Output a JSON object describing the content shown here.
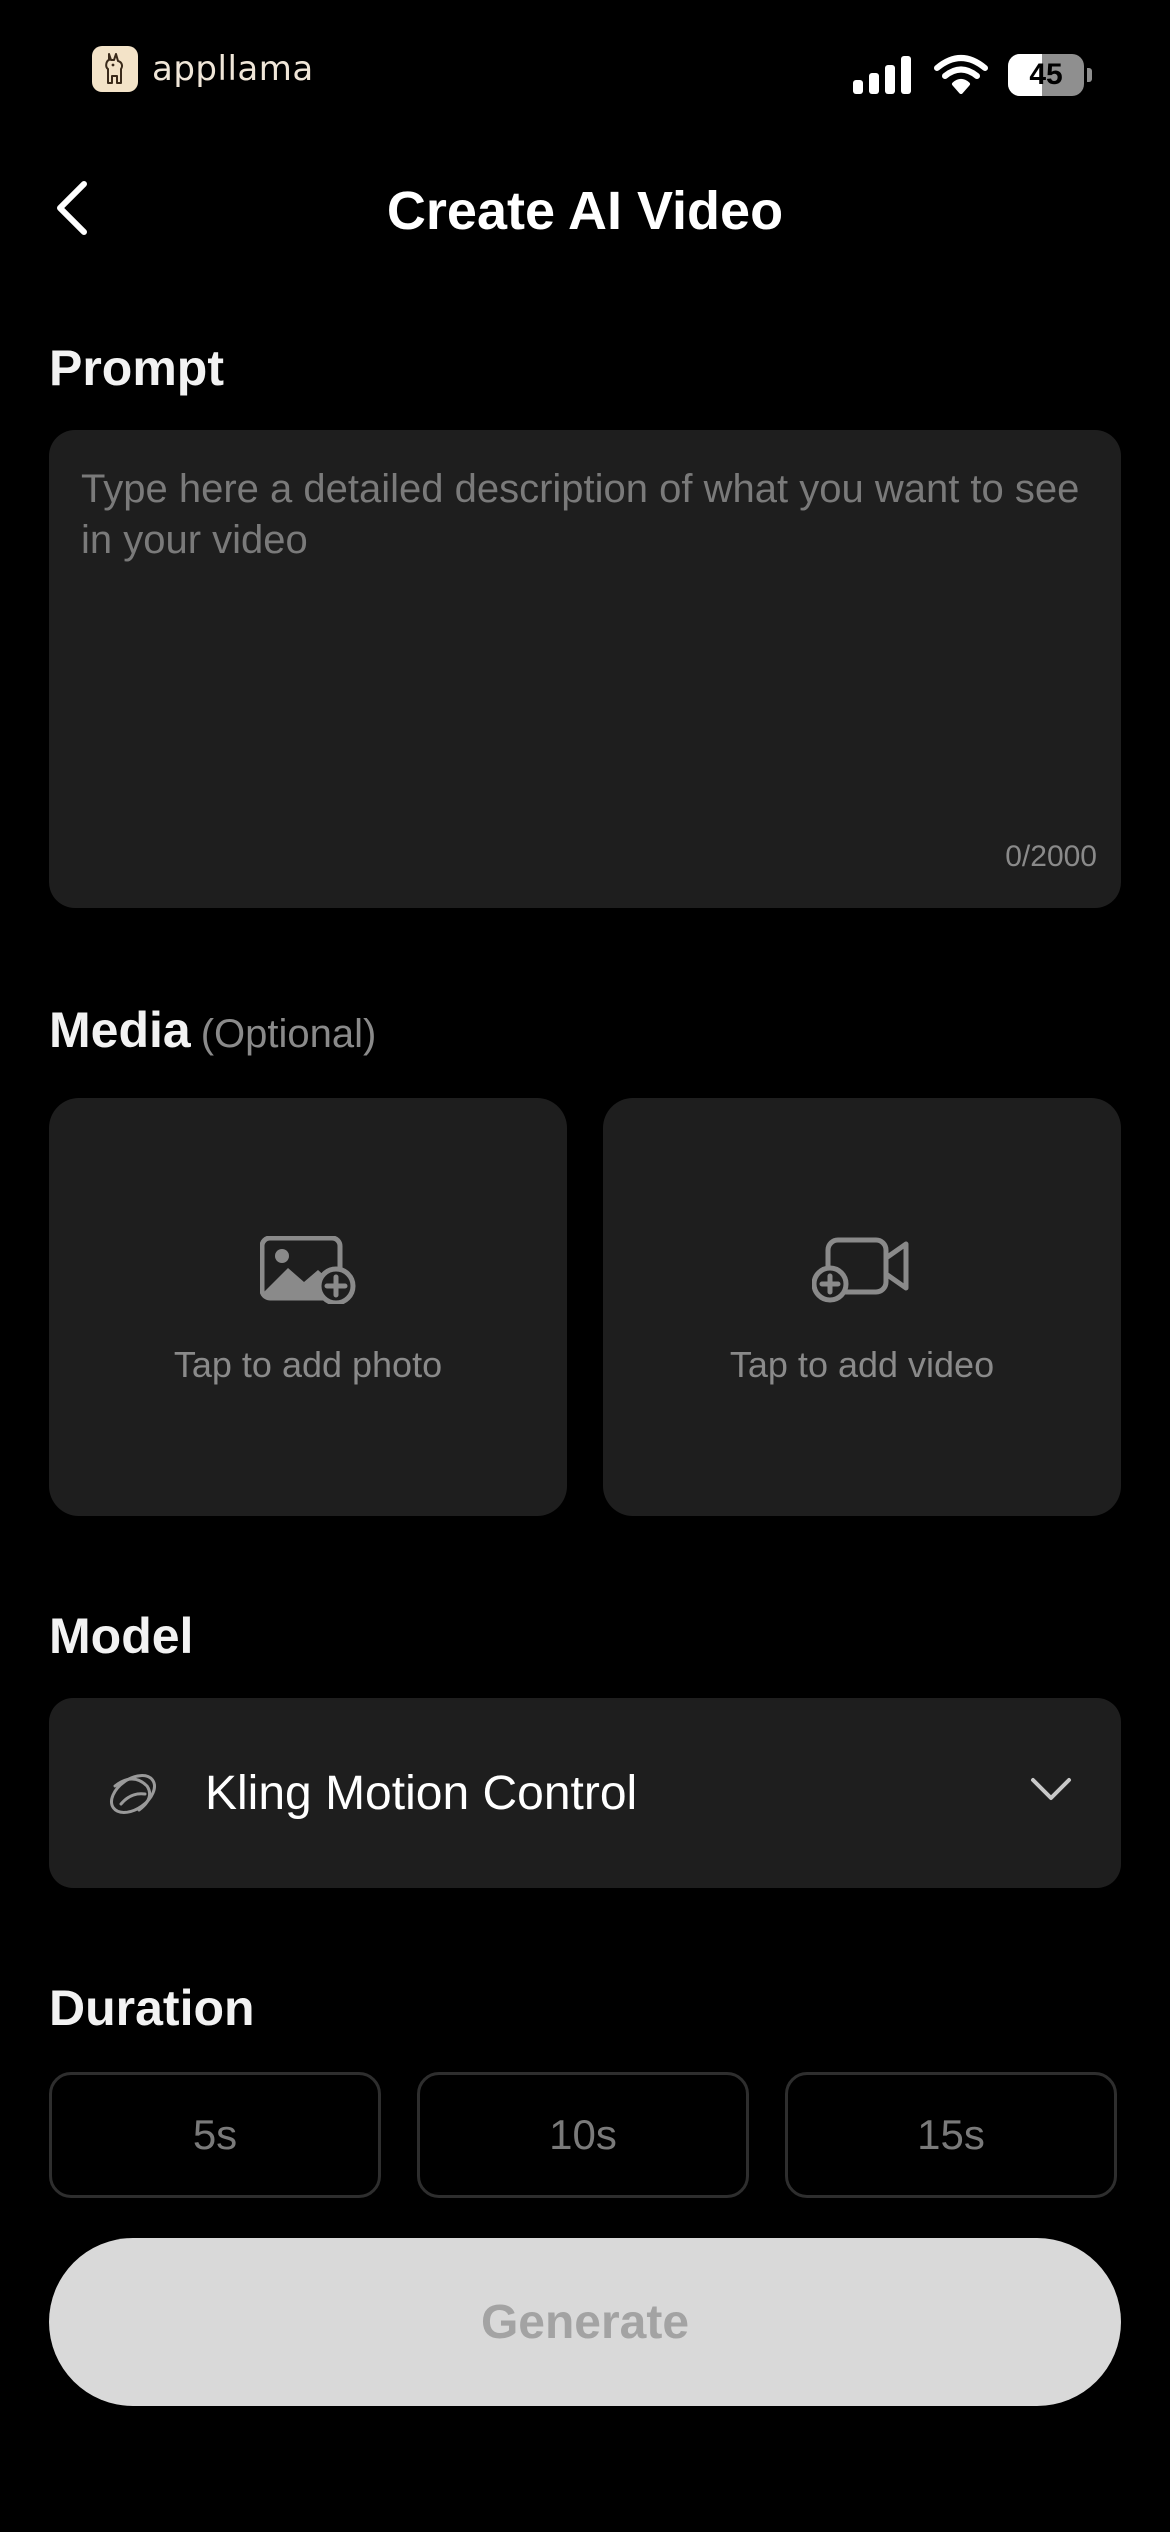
{
  "status_bar": {
    "brand_name": "appllama",
    "battery_level": "45",
    "battery_fraction": 0.45,
    "signal_icon": "cellular-signal-icon",
    "wifi_icon": "wifi-icon"
  },
  "header": {
    "back_icon": "chevron-left-icon",
    "title": "Create AI Video"
  },
  "prompt": {
    "label": "Prompt",
    "placeholder": "Type here a detailed description of what you want to see in your video",
    "value": "",
    "counter": "0/2000"
  },
  "media": {
    "label": "Media",
    "optional_label": "(Optional)",
    "photo": {
      "icon": "add-photo-icon",
      "label": "Tap to add photo"
    },
    "video": {
      "icon": "add-video-icon",
      "label": "Tap to add video"
    }
  },
  "model": {
    "label": "Model",
    "selected": "Kling Motion Control",
    "icon": "kling-logo-icon",
    "chevron_icon": "chevron-down-icon"
  },
  "duration": {
    "label": "Duration",
    "options": [
      "5s",
      "10s",
      "15s"
    ]
  },
  "generate": {
    "label": "Generate"
  },
  "colors": {
    "background": "#000000",
    "surface": "#1e1e1e",
    "muted_text": "#8a8a8a",
    "button_disabled_bg": "#d9d9d9",
    "button_disabled_text": "#a3a3a3"
  }
}
